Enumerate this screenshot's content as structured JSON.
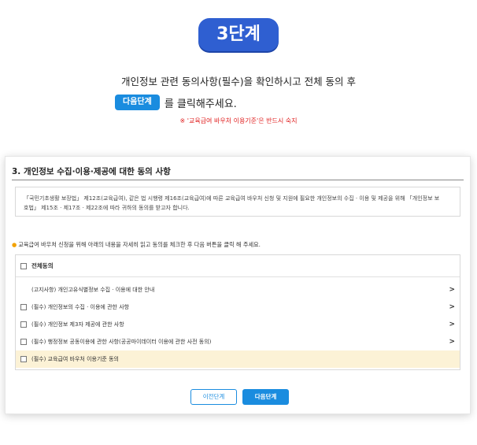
{
  "header": {
    "step_badge": "3단계",
    "instruction_line1": "개인정보 관련 동의사항(필수)을 확인하시고 전체 동의 후",
    "inline_button": "다음단계",
    "instruction_line2_suffix": "를 클릭해주세요.",
    "note": "※ '교육급여 바우처 이용기준'은 반드시 숙지"
  },
  "card": {
    "title": "3. 개인정보 수집·이용·제공에 대한 동의 사항",
    "notice_line1": "「국민기초생활 보장법」 제12조(교육급여), 같은 법 시행령 제16조(교육급여)에 따른 교육급여 바우처 신청 및 지원에 필요한 개인정보의 수집 · 이용 및 제공을 위해 「개인정보 보",
    "notice_line2": "호법」 제15조 · 제17조 · 제22조에 따라 귀하의 동의를 받고자 합니다.",
    "instruction": "교육급여 바우처 신청을 위해 아래의 내용을 자세히 읽고 동의를 체크한 후 다음 버튼을 클릭 해 주세요.",
    "agree_all": "전체동의",
    "items": [
      {
        "label": "(고지사항) 개인고유식별정보 수집 · 이용에 대한 안내"
      },
      {
        "label": "(필수) 개인정보의 수집 · 이용에 관한 사항"
      },
      {
        "label": "(필수) 개인정보 제3자 제공에 관한 사항"
      },
      {
        "label": "(필수) 행정정보 공동이용에 관한 사항(공공마이데이터 이용에 관한 사전 동의)"
      },
      {
        "label": "(필수) 교육급여 바우처 이용기준 동의"
      }
    ],
    "prev_button": "이전단계",
    "next_button": "다음단계"
  },
  "colors": {
    "badge": "#2f5fd1",
    "primary": "#1a8cdf",
    "highlight_row": "#fcf2d6",
    "note_red": "#e02020"
  }
}
